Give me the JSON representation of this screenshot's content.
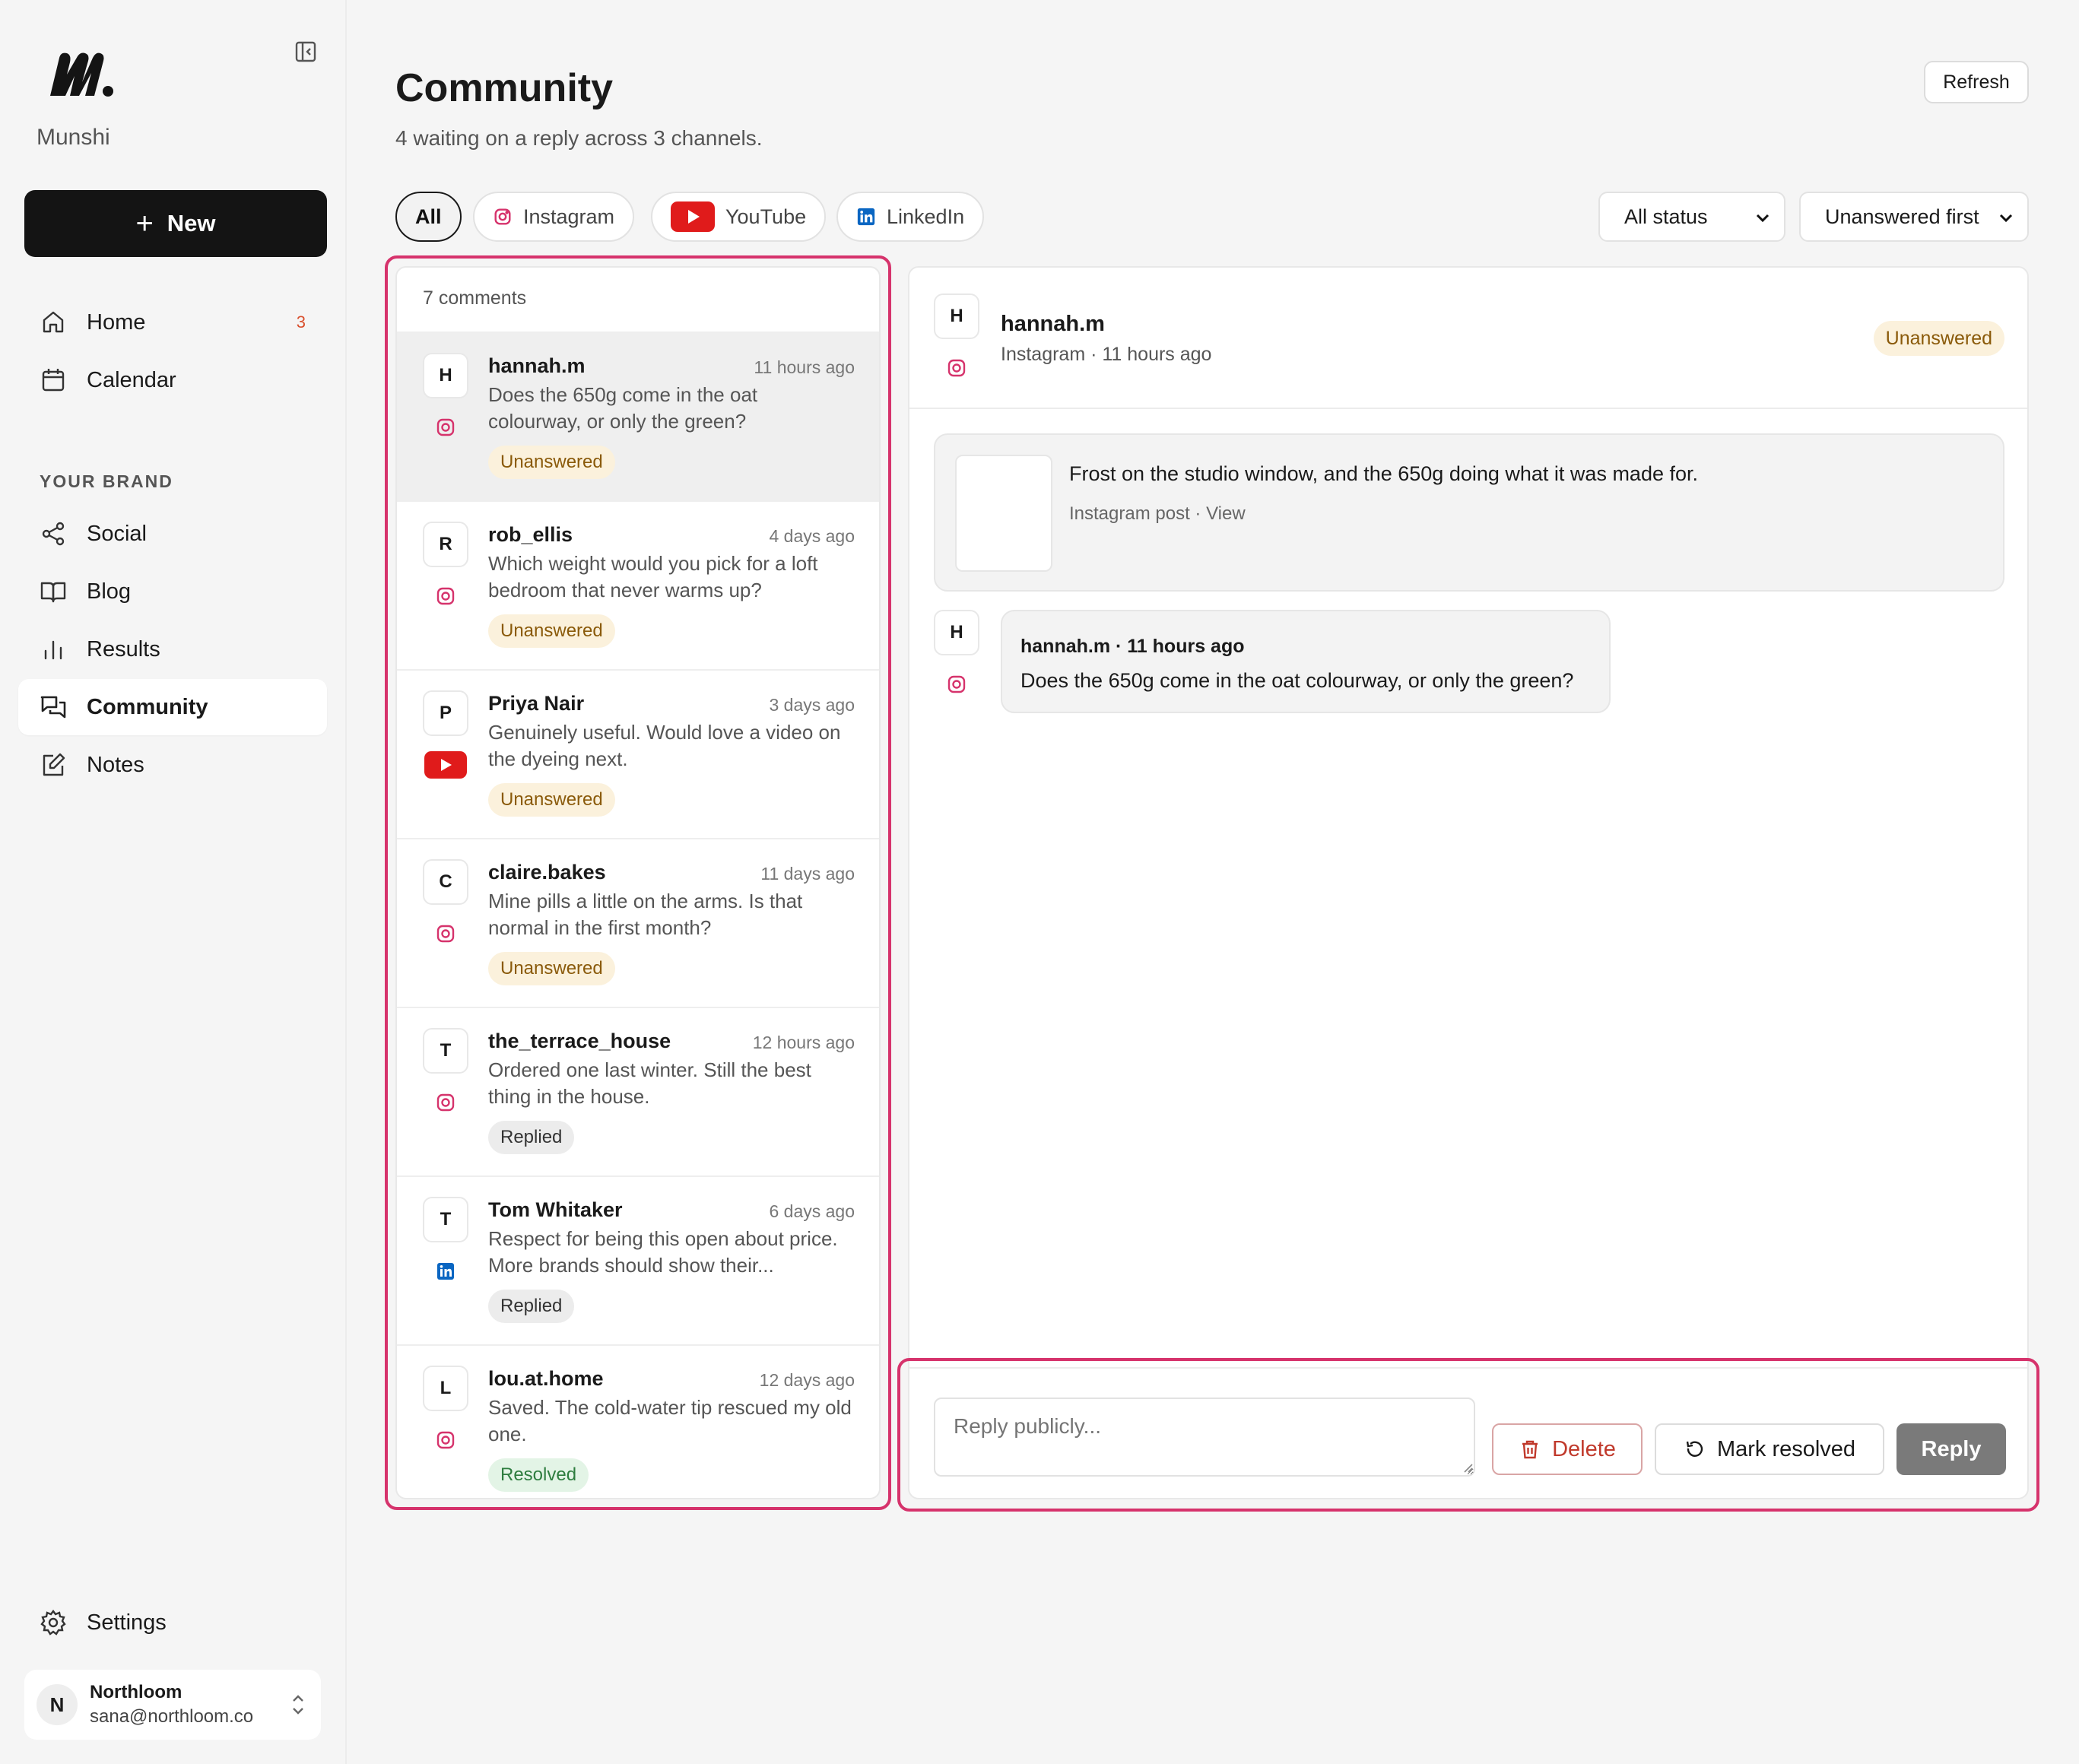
{
  "brand": {
    "name": "Munshi"
  },
  "sidebar": {
    "new_label": "New",
    "nav": [
      {
        "label": "Home",
        "badge": "3"
      },
      {
        "label": "Calendar"
      }
    ],
    "section_label": "YOUR BRAND",
    "brand_nav": [
      {
        "label": "Social"
      },
      {
        "label": "Blog"
      },
      {
        "label": "Results"
      },
      {
        "label": "Community",
        "active": true
      },
      {
        "label": "Notes"
      }
    ],
    "settings_label": "Settings",
    "account": {
      "initial": "N",
      "org": "Northloom",
      "email": "sana@northloom.co"
    }
  },
  "header": {
    "title": "Community",
    "subtitle": "4 waiting on a reply across 3 channels.",
    "refresh_label": "Refresh"
  },
  "filters": {
    "tabs": [
      {
        "label": "All",
        "active": true
      },
      {
        "label": "Instagram",
        "icon": "instagram-icon"
      },
      {
        "label": "YouTube",
        "icon": "youtube-icon"
      },
      {
        "label": "LinkedIn",
        "icon": "linkedin-icon"
      }
    ],
    "status_select": "All status",
    "sort_select": "Unanswered first"
  },
  "list": {
    "count_label": "7 comments",
    "comments": [
      {
        "initial": "H",
        "user": "hannah.m",
        "time": "11 hours ago",
        "text": "Does the 650g come in the oat colourway, or only the green?",
        "status": "Unanswered",
        "channel": "instagram"
      },
      {
        "initial": "R",
        "user": "rob_ellis",
        "time": "4 days ago",
        "text": "Which weight would you pick for a loft bedroom that never warms up?",
        "status": "Unanswered",
        "channel": "instagram"
      },
      {
        "initial": "P",
        "user": "Priya Nair",
        "time": "3 days ago",
        "text": "Genuinely useful. Would love a video on the dyeing next.",
        "status": "Unanswered",
        "channel": "youtube"
      },
      {
        "initial": "C",
        "user": "claire.bakes",
        "time": "11 days ago",
        "text": "Mine pills a little on the arms. Is that normal in the first month?",
        "status": "Unanswered",
        "channel": "instagram"
      },
      {
        "initial": "T",
        "user": "the_terrace_house",
        "time": "12 hours ago",
        "text": "Ordered one last winter. Still the best thing in the house.",
        "status": "Replied",
        "channel": "instagram"
      },
      {
        "initial": "T",
        "user": "Tom Whitaker",
        "time": "6 days ago",
        "text": "Respect for being this open about price. More brands should show their...",
        "status": "Replied",
        "channel": "linkedin"
      },
      {
        "initial": "L",
        "user": "lou.at.home",
        "time": "12 days ago",
        "text": "Saved. The cold-water tip rescued my old one.",
        "status": "Resolved",
        "channel": "instagram"
      }
    ]
  },
  "detail": {
    "initial": "H",
    "user": "hannah.m",
    "meta": "Instagram · 11 hours ago",
    "status": "Unanswered",
    "post_caption": "Frost on the studio window, and the 650g doing what it was made for.",
    "post_link": "Instagram post · View",
    "thread_meta": "hannah.m · 11 hours ago",
    "thread_text": "Does the 650g come in the oat colourway, or only the green?",
    "reply_placeholder": "Reply publicly...",
    "delete_label": "Delete",
    "resolve_label": "Mark resolved",
    "reply_label": "Reply"
  },
  "colors": {
    "accent": "#141414",
    "highlight": "#d6336c",
    "instagram": "#d6336c",
    "youtube": "#e01b1b",
    "linkedin": "#0a66c2",
    "unanswered_bg": "#fbf1dc",
    "resolved_bg": "#e3f4e6"
  }
}
